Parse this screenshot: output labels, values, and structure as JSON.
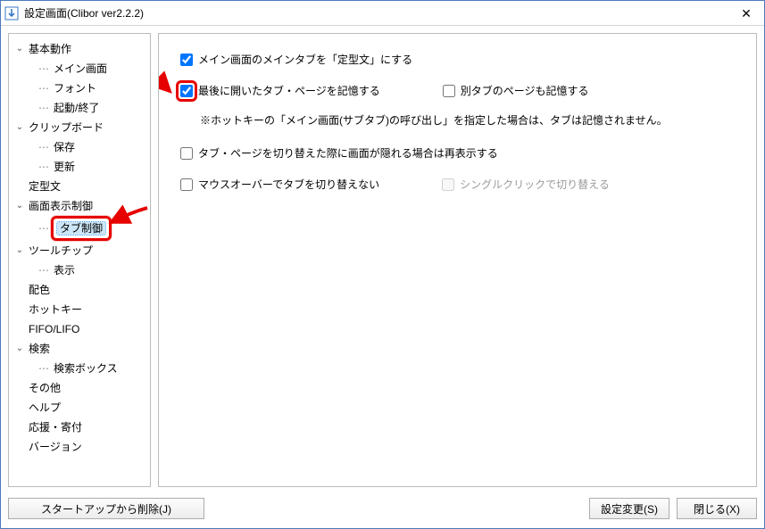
{
  "window": {
    "title": "設定画面(Clibor ver2.2.2)"
  },
  "tree": {
    "root": [
      {
        "label": "基本動作",
        "expanded": true,
        "children": [
          {
            "label": "メイン画面"
          },
          {
            "label": "フォント"
          },
          {
            "label": "起動/終了"
          }
        ]
      },
      {
        "label": "クリップボード",
        "expanded": true,
        "children": [
          {
            "label": "保存"
          },
          {
            "label": "更新"
          }
        ]
      },
      {
        "label": "定型文"
      },
      {
        "label": "画面表示制御",
        "expanded": true,
        "children": [
          {
            "label": "タブ制御",
            "selected": true,
            "highlight": true
          }
        ]
      },
      {
        "label": "ツールチップ",
        "expanded": true,
        "children": [
          {
            "label": "表示"
          }
        ]
      },
      {
        "label": "配色"
      },
      {
        "label": "ホットキー"
      },
      {
        "label": "FIFO/LIFO"
      },
      {
        "label": "検索",
        "expanded": true,
        "children": [
          {
            "label": "検索ボックス"
          }
        ]
      },
      {
        "label": "その他"
      },
      {
        "label": "ヘルプ"
      },
      {
        "label": "応援・寄付"
      },
      {
        "label": "バージョン"
      }
    ]
  },
  "options": {
    "main_tab_fixed": {
      "label": "メイン画面のメインタブを「定型文」にする",
      "checked": true
    },
    "remember_last_tab": {
      "label": "最後に開いたタブ・ページを記憶する",
      "checked": true,
      "highlight": true
    },
    "remember_other_tab": {
      "label": "別タブのページも記憶する",
      "checked": false
    },
    "note": "※ホットキーの「メイン画面(サブタブ)の呼び出し」を指定した場合は、タブは記憶されません。",
    "redisplay": {
      "label": "タブ・ページを切り替えた際に画面が隠れる場合は再表示する",
      "checked": false
    },
    "mouseover_notab": {
      "label": "マウスオーバーでタブを切り替えない",
      "checked": false
    },
    "singleclick_switch": {
      "label": "シングルクリックで切り替える",
      "checked": false,
      "disabled": true
    }
  },
  "footer": {
    "startup_delete": "スタートアップから削除(J)",
    "apply": "設定変更(S)",
    "close": "閉じる(X)"
  }
}
